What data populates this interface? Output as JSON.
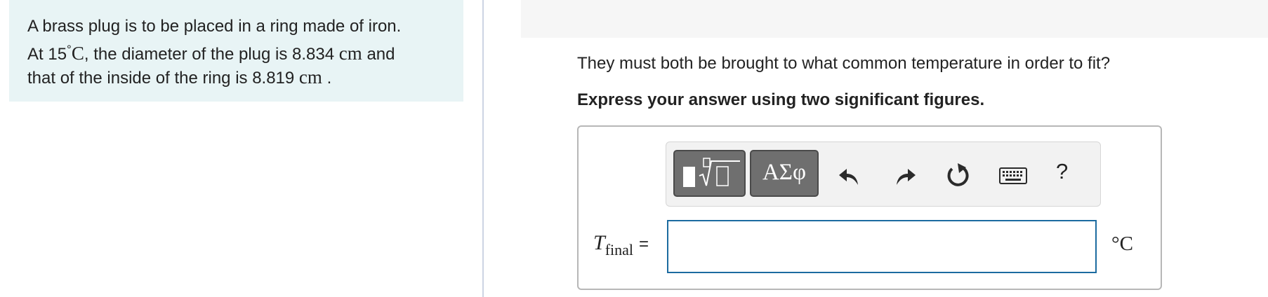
{
  "problem": {
    "line1": "A brass plug is to be placed in a ring made of iron.",
    "line2_prefix": "At 15",
    "degree_symbol": "°",
    "celsius_letter": "C",
    "line2_mid": ", the diameter of the plug is 8.834 ",
    "unit_cm": "cm",
    "line2_suffix": " and",
    "line3_prefix": "that of the inside of the ring is 8.819 ",
    "line3_suffix": " ."
  },
  "question": {
    "prompt": "They must both be brought to what common temperature in order to fit?",
    "instruction": "Express your answer using two significant figures."
  },
  "toolbar": {
    "templates_icon": "templates-icon",
    "greek_label": "ΑΣφ",
    "undo_icon": "undo-icon",
    "redo_icon": "redo-icon",
    "reset_icon": "reset-icon",
    "keyboard_icon": "keyboard-icon",
    "help_label": "?"
  },
  "answer": {
    "variable": "T",
    "subscript": "final",
    "equals": "=",
    "value": "",
    "unit": "°C"
  },
  "colors": {
    "problem_bg": "#e8f4f5",
    "input_border": "#1c6ba0",
    "toolbar_button": "#6f6f6f"
  }
}
